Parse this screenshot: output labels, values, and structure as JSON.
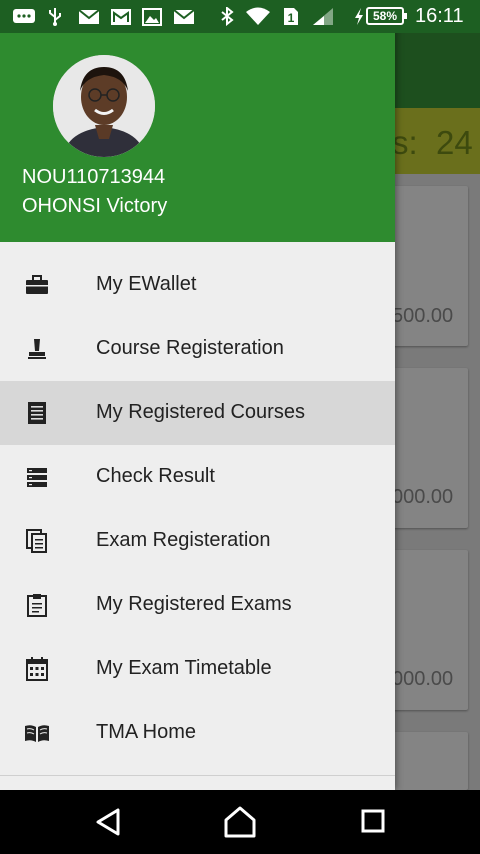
{
  "status_bar": {
    "battery": "58%",
    "time": "16:11",
    "icons": [
      "chat-icon",
      "usb-icon",
      "mail-icon",
      "gmail-icon",
      "image-icon",
      "mail-icon",
      "bluetooth-icon",
      "wifi-icon",
      "sim-1-icon",
      "signal-icon",
      "charging-icon",
      "battery-icon"
    ]
  },
  "drawer": {
    "user_id": "NOU110713944",
    "user_name": "OHONSI Victory",
    "items": [
      {
        "label": "My EWallet",
        "icon": "briefcase-icon",
        "active": false
      },
      {
        "label": "Course Registeration",
        "icon": "stamp-icon",
        "active": false
      },
      {
        "label": "My Registered Courses",
        "icon": "list-icon",
        "active": true
      },
      {
        "label": "Check Result",
        "icon": "rows-icon",
        "active": false
      },
      {
        "label": "Exam Registeration",
        "icon": "documents-icon",
        "active": false
      },
      {
        "label": "My Registered Exams",
        "icon": "clipboard-icon",
        "active": false
      },
      {
        "label": "My Exam Timetable",
        "icon": "calendar-icon",
        "active": false
      },
      {
        "label": "TMA Home",
        "icon": "book-icon",
        "active": false
      }
    ]
  },
  "background": {
    "count_text": "s:  24",
    "amounts": [
      "500.00",
      "000.00",
      "000.00"
    ]
  },
  "nav_bar": {
    "buttons": [
      "back-icon",
      "home-icon",
      "recents-icon"
    ]
  },
  "colors": {
    "drawer_header": "#2e8b2f",
    "status_bar": "#1d5f22",
    "active_item": "#d7d7d7",
    "drawer_bg": "#eeeeee"
  }
}
